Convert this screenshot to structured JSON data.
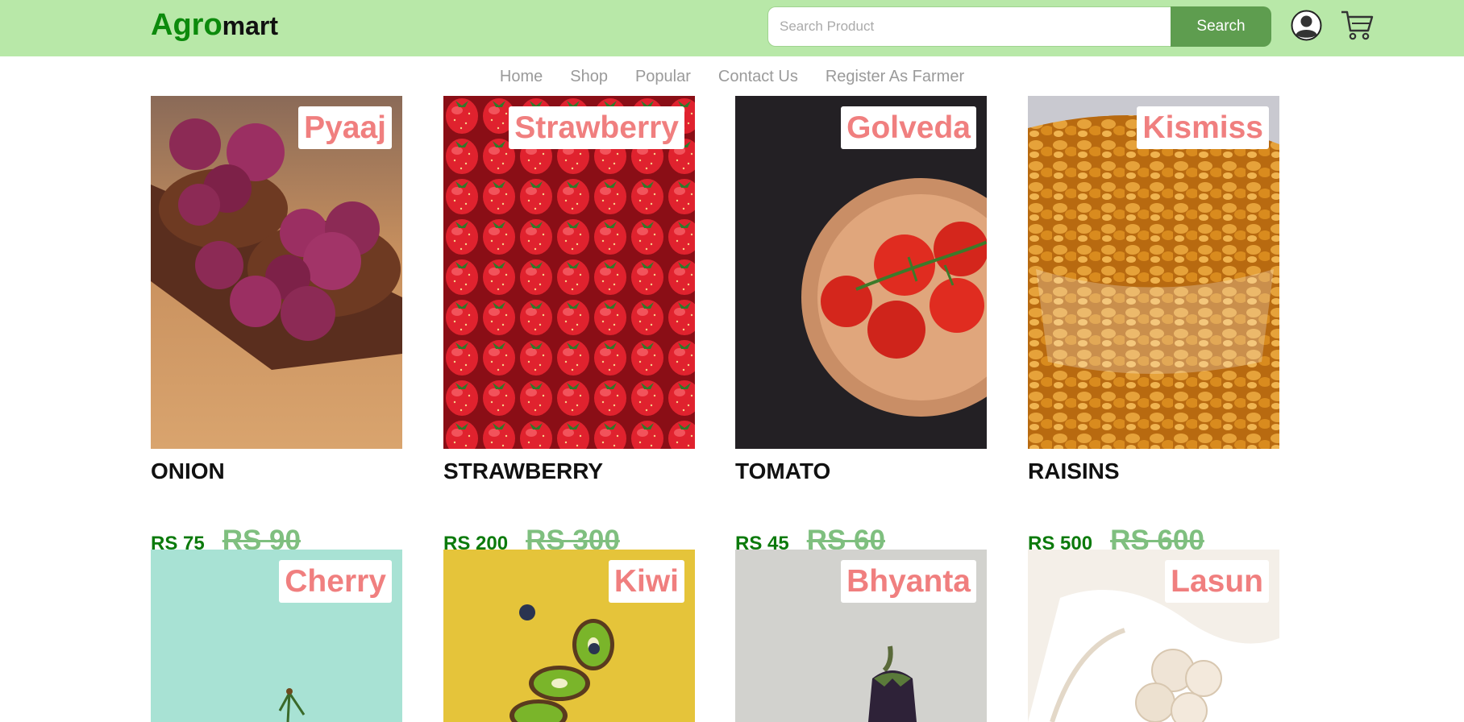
{
  "header": {
    "logo_part1": "Agro",
    "logo_part2": "mart",
    "search_placeholder": "Search Product",
    "search_button": "Search",
    "user_icon": "user-circle-icon",
    "cart_icon": "cart-icon"
  },
  "nav": {
    "items": [
      "Home",
      "Shop",
      "Popular",
      "Contact Us",
      "Register As Farmer"
    ]
  },
  "products": [
    {
      "tag": "Pyaaj",
      "name": "ONION",
      "price": "RS 75",
      "old_price": "RS 90",
      "image": "onions-in-wooden-bowls"
    },
    {
      "tag": "Strawberry",
      "name": "STRAWBERRY",
      "price": "RS 200",
      "old_price": "RS 300",
      "image": "strawberries"
    },
    {
      "tag": "Golveda",
      "name": "TOMATO",
      "price": "RS 45",
      "old_price": "RS 60",
      "image": "tomatoes-on-wooden-plate"
    },
    {
      "tag": "Kismiss",
      "name": "RAISINS",
      "price": "RS 500",
      "old_price": "RS 600",
      "image": "raisins-in-glass-bowl"
    },
    {
      "tag": "Cherry",
      "name": "",
      "price": "",
      "old_price": "",
      "image": "cherry-on-mint-background"
    },
    {
      "tag": "Kiwi",
      "name": "",
      "price": "",
      "old_price": "",
      "image": "kiwi-slices-on-yellow"
    },
    {
      "tag": "Bhyanta",
      "name": "",
      "price": "",
      "old_price": "",
      "image": "eggplant-on-grey"
    },
    {
      "tag": "Lasun",
      "name": "",
      "price": "",
      "old_price": "",
      "image": "garlic-in-cloth"
    }
  ],
  "colors": {
    "header_bg": "#b8e8a8",
    "logo_green": "#0c8a0c",
    "search_button_bg": "#5e9d4f",
    "tag_text": "#f07f7f",
    "price_now": "#0c7a0c",
    "price_old": "#7fbf7f"
  }
}
